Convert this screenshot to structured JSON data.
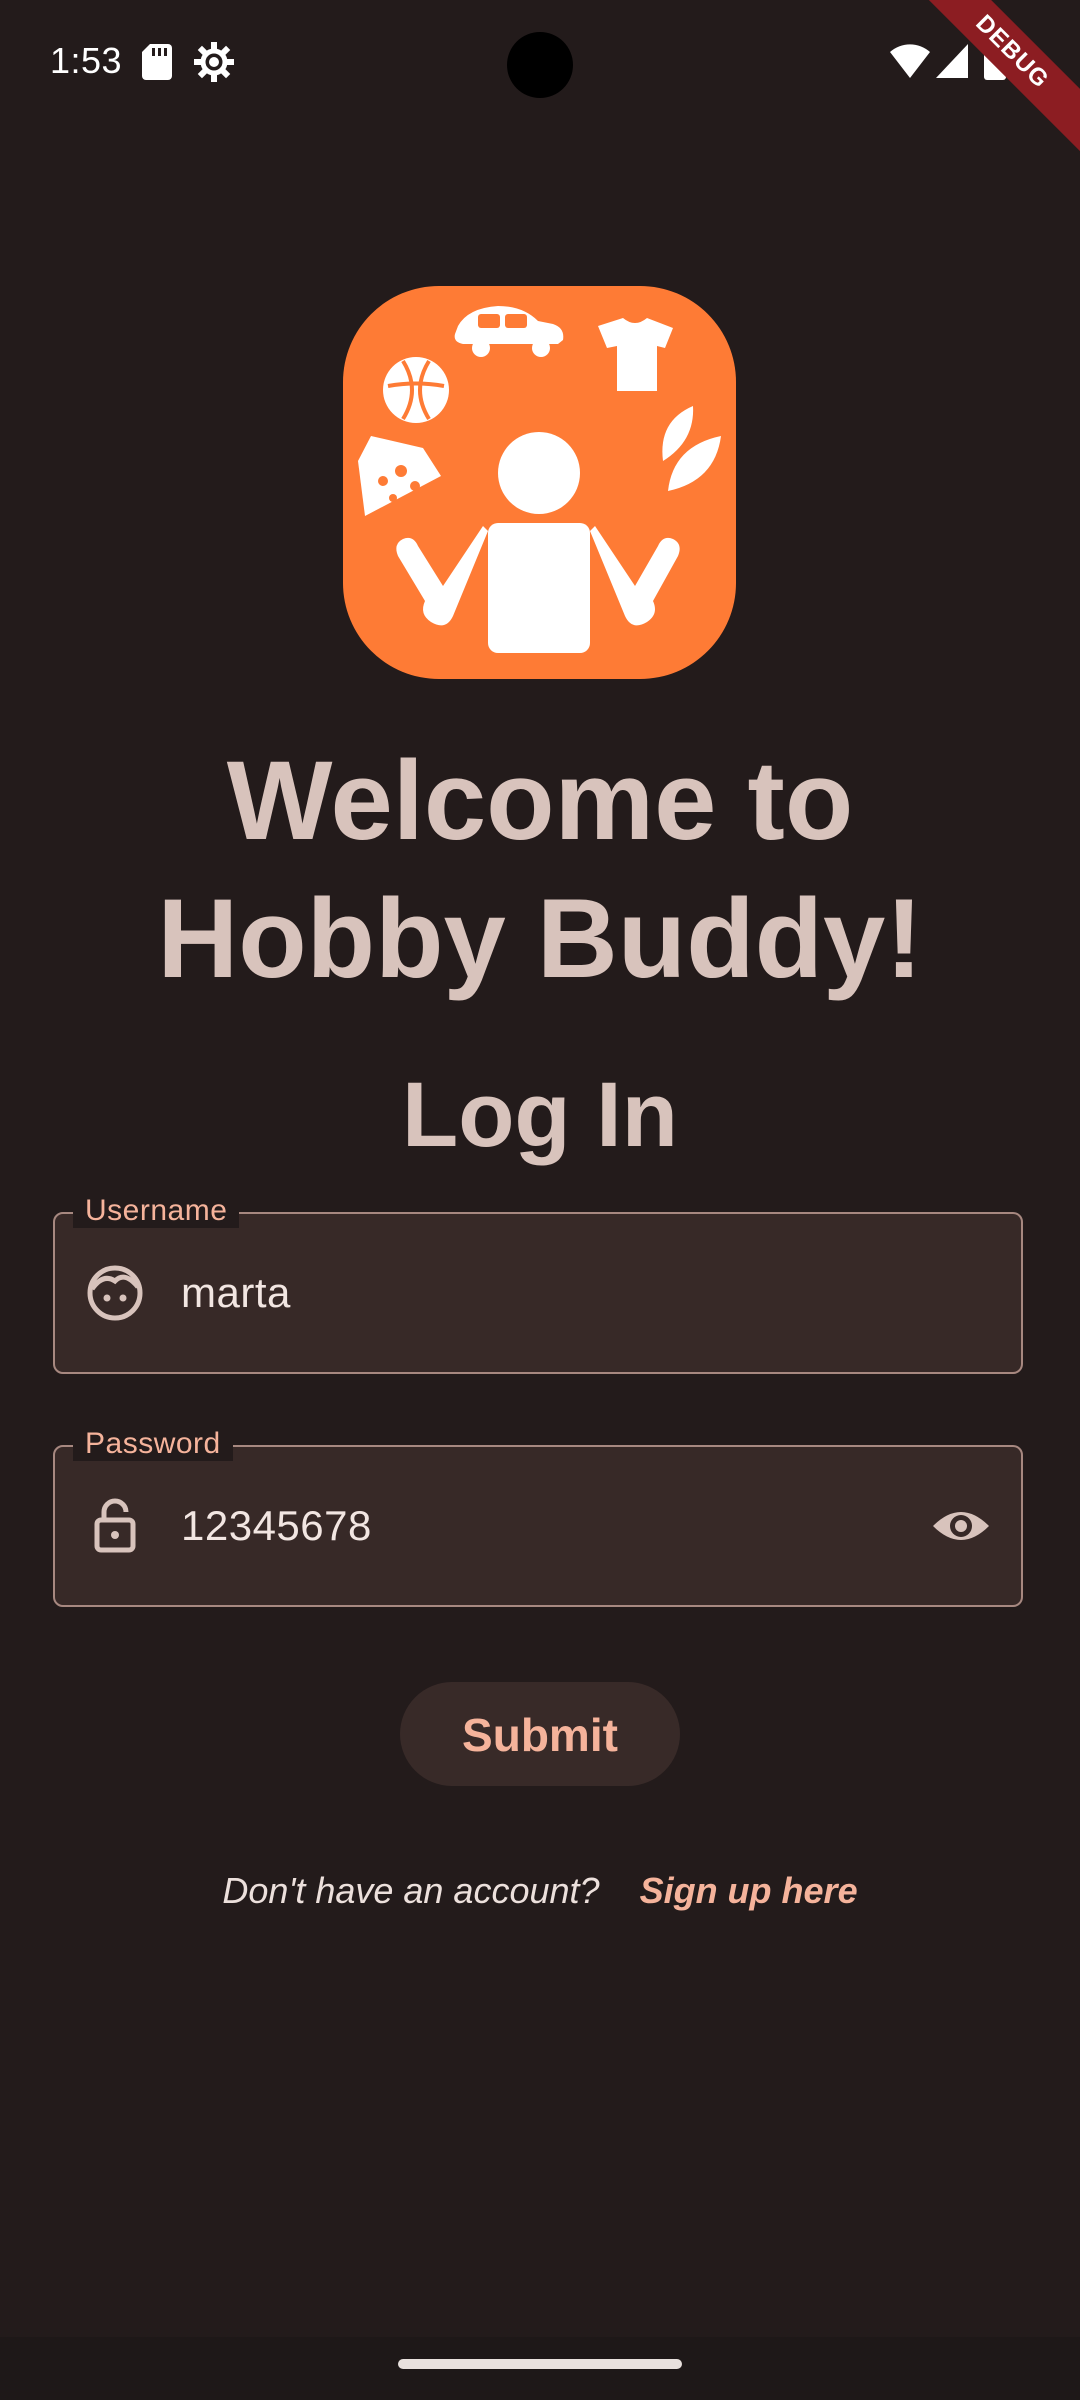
{
  "status_bar": {
    "time": "1:53",
    "icons": [
      "sd-card-icon",
      "settings-gear-icon",
      "wifi-icon",
      "cell-signal-icon",
      "battery-icon"
    ],
    "debug_banner": "DEBUG"
  },
  "logo": {
    "icon": "hobby-buddy-juggler-logo",
    "background_color": "#fe7b35"
  },
  "welcome": {
    "line1": "Welcome to",
    "line2": "Hobby Buddy!"
  },
  "login": {
    "heading": "Log In",
    "username": {
      "label": "Username",
      "value": "marta",
      "icon": "face-icon"
    },
    "password": {
      "label": "Password",
      "value": "12345678",
      "icon": "lock-open-icon",
      "toggle_icon": "eye-icon"
    },
    "submit_label": "Submit"
  },
  "signup": {
    "prompt": "Don't have an account?",
    "link": "Sign up here"
  },
  "colors": {
    "background": "#231b1b",
    "accent": "#f5b39b",
    "text": "#d8c3bc",
    "field_background": "#372927",
    "field_border": "#a78880"
  }
}
